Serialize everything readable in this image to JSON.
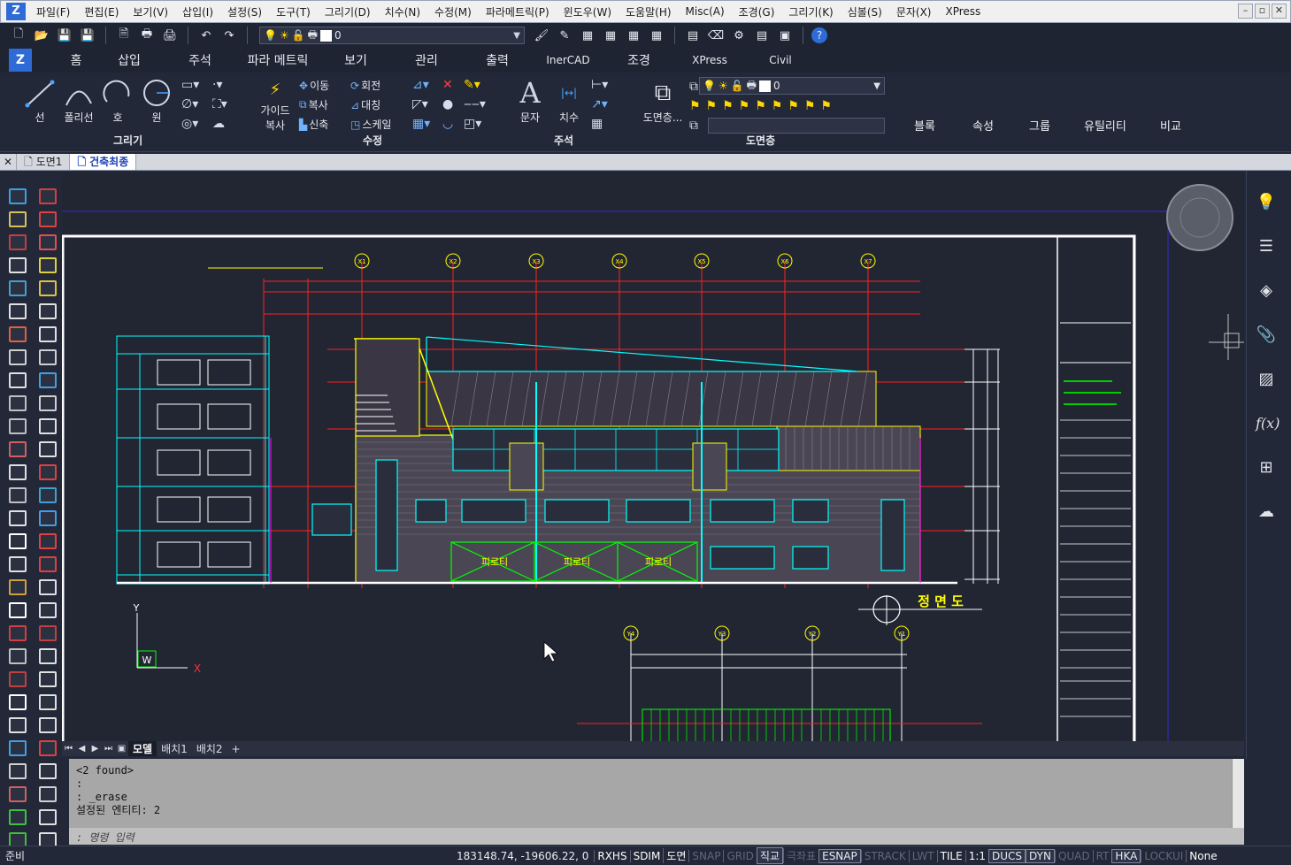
{
  "menu": {
    "items": [
      "파일(F)",
      "편집(E)",
      "보기(V)",
      "삽입(I)",
      "설정(S)",
      "도구(T)",
      "그리기(D)",
      "치수(N)",
      "수정(M)",
      "파라메트릭(P)",
      "윈도우(W)",
      "도움말(H)",
      "Misc(A)",
      "조경(G)",
      "그리기(K)",
      "심볼(S)",
      "문자(X)",
      "XPress"
    ]
  },
  "quick_access": {
    "layer_value": "0"
  },
  "ribbon_tabs": [
    "홈",
    "삽입",
    "주석",
    "파라 메트릭",
    "보기",
    "관리",
    "출력",
    "InerCAD",
    "조경",
    "XPress",
    "Civil"
  ],
  "ribbon": {
    "draw": {
      "line": "선",
      "polyline": "폴리선",
      "arc": "호",
      "circle": "원",
      "label": "그리기"
    },
    "modify": {
      "guide_copy_1": "가이드",
      "guide_copy_2": "복사",
      "move": "이동",
      "rotate": "회전",
      "copy": "복사",
      "mirror": "대칭",
      "stretch": "신축",
      "scale": "스케일",
      "label": "수정"
    },
    "annotation": {
      "text": "문자",
      "dimension": "치수",
      "label": "주석"
    },
    "layers": {
      "layer_state": "도면층...",
      "layer_value": "0",
      "label": "도면층"
    },
    "right_groups": [
      "블록",
      "속성",
      "그룹",
      "유틸리티",
      "비교"
    ]
  },
  "doc_tabs": [
    "도면1",
    "건축최종"
  ],
  "layout_tabs": [
    "모델",
    "배치1",
    "배치2",
    "+"
  ],
  "drawing": {
    "title": "정 면 도",
    "shop_label": "피로티",
    "axis_top": [
      "X1",
      "X2",
      "X3",
      "X4",
      "X5",
      "X6",
      "X7"
    ],
    "axis_bottom": [
      "Y4",
      "Y3",
      "Y2",
      "Y1"
    ],
    "ucs_y": "Y",
    "ucs_x": "X",
    "ucs_w": "W"
  },
  "command": {
    "lines": [
      "<2 found>",
      ":",
      ": _erase",
      "설정된 엔티티: 2"
    ],
    "prompt": ": 명령 입력"
  },
  "status": {
    "ready": "준비",
    "coords": "183148.74, -19606.22, 0",
    "toggles": [
      {
        "label": "RXHS",
        "state": "on"
      },
      {
        "label": "SDIM",
        "state": "on"
      },
      {
        "label": "도면",
        "state": "on"
      },
      {
        "label": "SNAP",
        "state": "off"
      },
      {
        "label": "GRID",
        "state": "off"
      },
      {
        "label": "직교",
        "state": "box"
      },
      {
        "label": "극좌표",
        "state": "off"
      },
      {
        "label": "ESNAP",
        "state": "box"
      },
      {
        "label": "STRACK",
        "state": "off"
      },
      {
        "label": "LWT",
        "state": "off"
      },
      {
        "label": "TILE",
        "state": "on"
      },
      {
        "label": "1:1",
        "state": "on"
      },
      {
        "label": "DUCS",
        "state": "box"
      },
      {
        "label": "DYN",
        "state": "box"
      },
      {
        "label": "QUAD",
        "state": "off"
      },
      {
        "label": "RT",
        "state": "off"
      },
      {
        "label": "HKA",
        "state": "box"
      },
      {
        "label": "LOCKUI",
        "state": "off"
      },
      {
        "label": "None",
        "state": "on"
      }
    ]
  },
  "colors": {
    "accent": "#2e6bd6",
    "canvas": "#222633",
    "yellow": "#ffff00",
    "cyan": "#00ffff",
    "red": "#ff0000",
    "magenta": "#ff00ff",
    "green": "#00ff00"
  }
}
